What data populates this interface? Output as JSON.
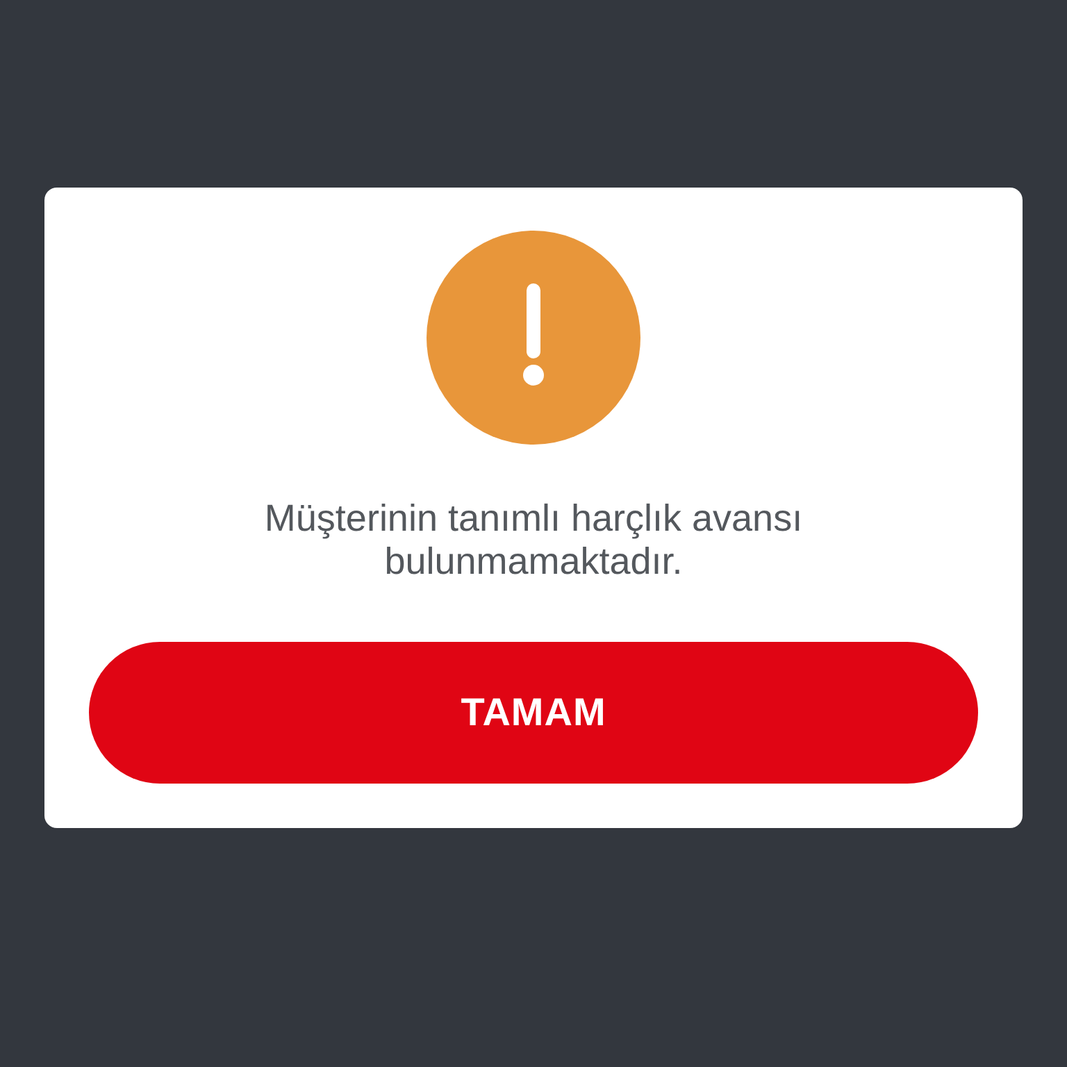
{
  "dialog": {
    "message": "Müşterinin tanımlı harçlık avansı bulunmamaktadır.",
    "buttons": [
      {
        "label": "TAMAM"
      }
    ]
  }
}
